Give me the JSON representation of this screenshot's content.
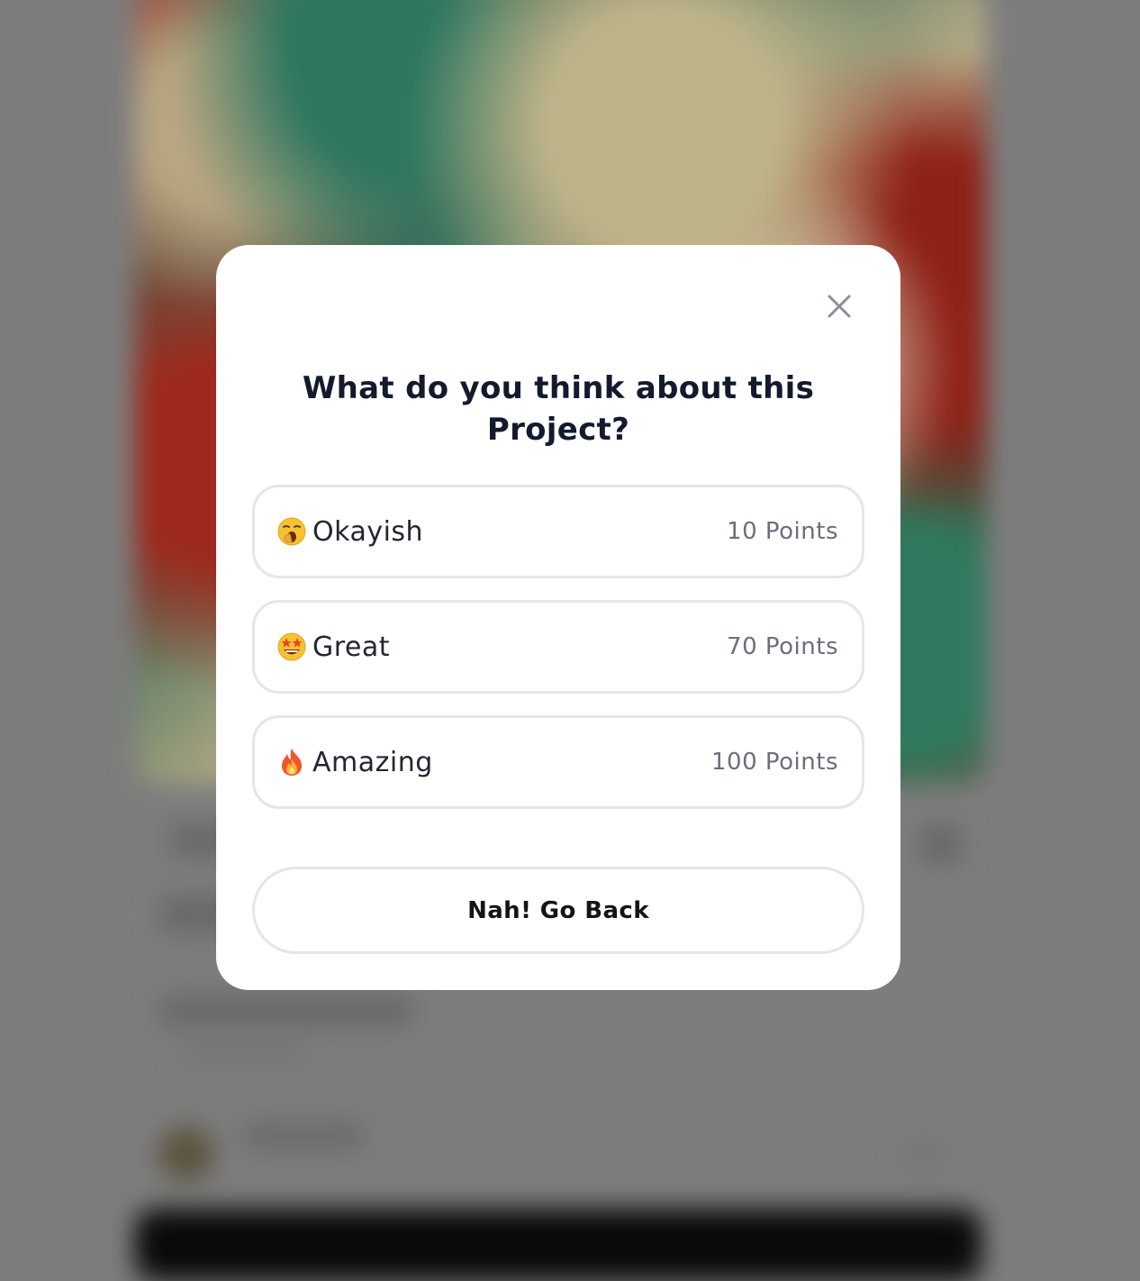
{
  "modal": {
    "title": "What do you think about this Project?",
    "options": [
      {
        "emoji_icon": "yawning-face-icon",
        "label": "Okayish",
        "points": "10 Points"
      },
      {
        "emoji_icon": "star-struck-face-icon",
        "label": "Great",
        "points": "70 Points"
      },
      {
        "emoji_icon": "fire-icon",
        "label": "Amazing",
        "points": "100 Points"
      }
    ],
    "cancel_label": "Nah! Go Back",
    "close_icon": "close-icon"
  },
  "colors": {
    "overlay": "#7d7d7d",
    "modal_bg": "#ffffff",
    "title": "#141a2e",
    "option_border": "#e6e6e9",
    "points_text": "#6a6f7b"
  }
}
